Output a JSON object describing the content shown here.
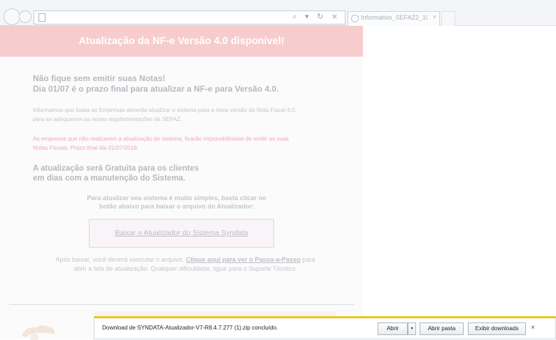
{
  "browser": {
    "tab_label": "Informativo_SEFAZ2_10082...",
    "tab_close": "×",
    "address_controls": "⌕ ▾ ↻ ×"
  },
  "banner": {
    "title": "Atualização da NF-e Versão 4.0 disponível!"
  },
  "content": {
    "notice_line1": "Não fique sem emitir suas Notas!",
    "notice_line2": "Dia 01/07 é o prazo final para atualizar a NF-e para Versão 4.0.",
    "info_line1": "Informamos que todas as Empresas deverão atualizar o sistema para a nova versão da Nota Fiscal 4.0,",
    "info_line2": "para se adequarem as novas regulamentações da SEFAZ.",
    "warn_line1": "As empresas que não realizarem a atualização do sistema, ficarão impossibilitadas de emitir as suas",
    "warn_line2": "Notas Fiscais. Prazo final dia 01/07/2018.",
    "free_line1": "A atualização será Gratuita para os clientes",
    "free_line2": "em dias com a manutenção do Sistema.",
    "simple_line1": "Para atualizar seu sistema é muito simples, basta clicar no",
    "simple_line2": "botão abaixo para baixar o arquivo do Atualizador:",
    "download_link": "Baixar o Atualizador do Sistema Syndata",
    "after_pre": "Após baixar, você deverá executar o arquivo.",
    "after_link": "Clique aqui para ver o Passo-a-Passo",
    "after_post": "para",
    "after_line2": "abrir a tela de atualização. Qualquer dificuldade, ligue para o Suporte Técnico."
  },
  "download_bar": {
    "message": "Download de SYNDATA-Atualizador-V7-R8.4.7.277 (1).zip concluído.",
    "open_label": "Abrir",
    "dropdown_label": "▾",
    "open_folder_label": "Abrir pasta",
    "view_downloads_label": "Exibir downloads",
    "close_label": "×"
  }
}
